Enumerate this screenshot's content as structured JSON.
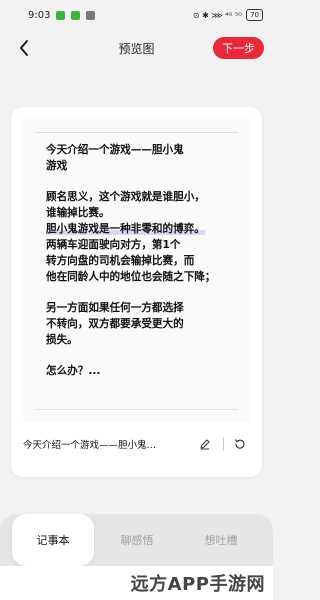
{
  "status_bar": {
    "time": "9:03",
    "right_indicators": "⊙ ✱ ⋙ ⁴ᴳ ⁵ᴳ",
    "battery": "70"
  },
  "header": {
    "title": "预览图",
    "next_button": "下一步"
  },
  "note": {
    "paragraphs": [
      "今天介绍一个游戏——胆小鬼\n游戏",
      "顾名思义，这个游戏就是谁胆小，\n谁输掉比赛。",
      "胆小鬼游戏是一种非零和的博弈。",
      "两辆车迎面驶向对方，第1个\n转方向盘的司机会输掉比赛，而\n他在同龄人中的地位也会随之下降；",
      "另一方面如果任何一方都选择\n不转向，双方都要承受更大的\n损失。",
      "怎么办？..."
    ],
    "caption": "今天介绍一个游戏——胆小鬼…"
  },
  "tabs": [
    {
      "label": "记事本",
      "active": true
    },
    {
      "label": "聊感悟",
      "active": false
    },
    {
      "label": "想吐槽",
      "active": false
    }
  ],
  "watermark": "远方APP手游网"
}
